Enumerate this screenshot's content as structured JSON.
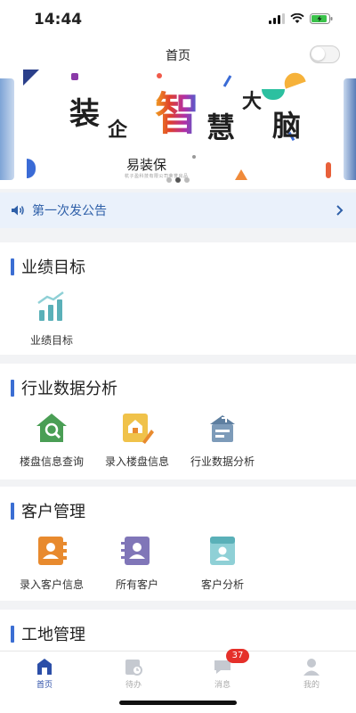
{
  "status_bar": {
    "time": "14:44"
  },
  "navbar": {
    "title": "首页"
  },
  "banner": {
    "headline_chars": [
      "装",
      "企",
      "智",
      "慧",
      "大",
      "脑"
    ],
    "brand": "易装保",
    "brand_subtitle": "杭子盈科技有限公司荣誉出品",
    "slide_count": 3,
    "active_slide": 2
  },
  "notice": {
    "text": "第一次发公告"
  },
  "sections": [
    {
      "title": "业绩目标",
      "items": [
        {
          "label": "业绩目标",
          "icon": "bar-chart-icon"
        }
      ]
    },
    {
      "title": "行业数据分析",
      "items": [
        {
          "label": "楼盘信息查询",
          "icon": "house-search-icon"
        },
        {
          "label": "录入楼盘信息",
          "icon": "house-edit-icon"
        },
        {
          "label": "行业数据分析",
          "icon": "data-analysis-icon"
        }
      ]
    },
    {
      "title": "客户管理",
      "items": [
        {
          "label": "录入客户信息",
          "icon": "customer-book-icon"
        },
        {
          "label": "所有客户",
          "icon": "customer-list-icon"
        },
        {
          "label": "客户分析",
          "icon": "customer-analysis-icon"
        }
      ]
    },
    {
      "title": "工地管理",
      "items": []
    }
  ],
  "tabbar": {
    "tabs": [
      {
        "label": "首页",
        "icon": "home-icon",
        "active": true
      },
      {
        "label": "待办",
        "icon": "todo-icon",
        "active": false
      },
      {
        "label": "消息",
        "icon": "message-icon",
        "active": false,
        "badge": "37"
      },
      {
        "label": "我的",
        "icon": "profile-icon",
        "active": false
      }
    ]
  },
  "colors": {
    "accent": "#3b6ed3",
    "notice_bg": "#eaf1fb",
    "notice_text": "#2e5fa8",
    "badge": "#e5302a",
    "icon_green": "#4a9e55",
    "icon_orange": "#e88a2e",
    "icon_slate": "#5e7fa0",
    "icon_purple": "#8076b8",
    "icon_teal": "#5ab0b8"
  }
}
